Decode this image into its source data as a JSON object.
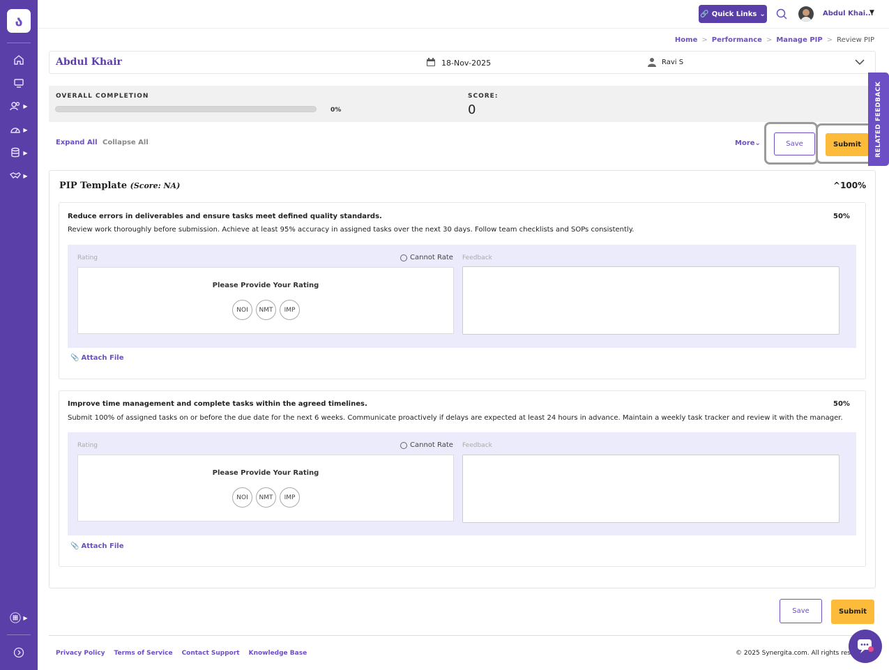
{
  "topbar": {
    "quick_links": "Quick Links",
    "user_name": "Abdul Khai..."
  },
  "breadcrumb": [
    "Home",
    "Performance",
    "Manage PIP",
    "Review PIP"
  ],
  "employee": {
    "name": "Abdul Khair",
    "date": "18-Nov-2025",
    "manager": "Ravi S"
  },
  "stats": {
    "overall_label": "OVERALL COMPLETION",
    "completion_percent": "0%",
    "completion_value": 0,
    "score_label": "SCORE:",
    "score": "0"
  },
  "actions": {
    "expand_all": "Expand All",
    "collapse_all": "Collapse All",
    "more": "More",
    "save": "Save",
    "submit": "Submit"
  },
  "related_feedback": "RELATED FEEDBACK",
  "template": {
    "title": "PIP Template",
    "score": "(Score: NA)",
    "percent": "100%"
  },
  "goals": [
    {
      "title": "Reduce errors in deliverables and ensure tasks meet defined quality standards.",
      "weight": "50%",
      "description": "Review work thoroughly before submission. Achieve at least 95% accuracy in assigned tasks over the next 30 days. Follow team checklists and SOPs consistently."
    },
    {
      "title": "Improve time management and complete tasks within the agreed timelines.",
      "weight": "50%",
      "description": "Submit 100% of assigned tasks on or before the due date for the next 6 weeks. Communicate proactively if delays are expected at least 24 hours in advance. Maintain a weekly task tracker and review it with the manager."
    }
  ],
  "rating": {
    "label": "Rating",
    "cannot_rate": "Cannot Rate",
    "feedback_label": "Feedback",
    "prompt": "Please Provide Your Rating",
    "options": [
      "NOI",
      "NMT",
      "IMP"
    ],
    "attach": "Attach File"
  },
  "footer": {
    "links": [
      "Privacy Policy",
      "Terms of Service",
      "Contact Support",
      "Knowledge Base"
    ],
    "copyright": "© 2025 Synergita.com. All rights res"
  },
  "colors": {
    "primary": "#5b3fa8",
    "accent": "#fdbb3b"
  }
}
